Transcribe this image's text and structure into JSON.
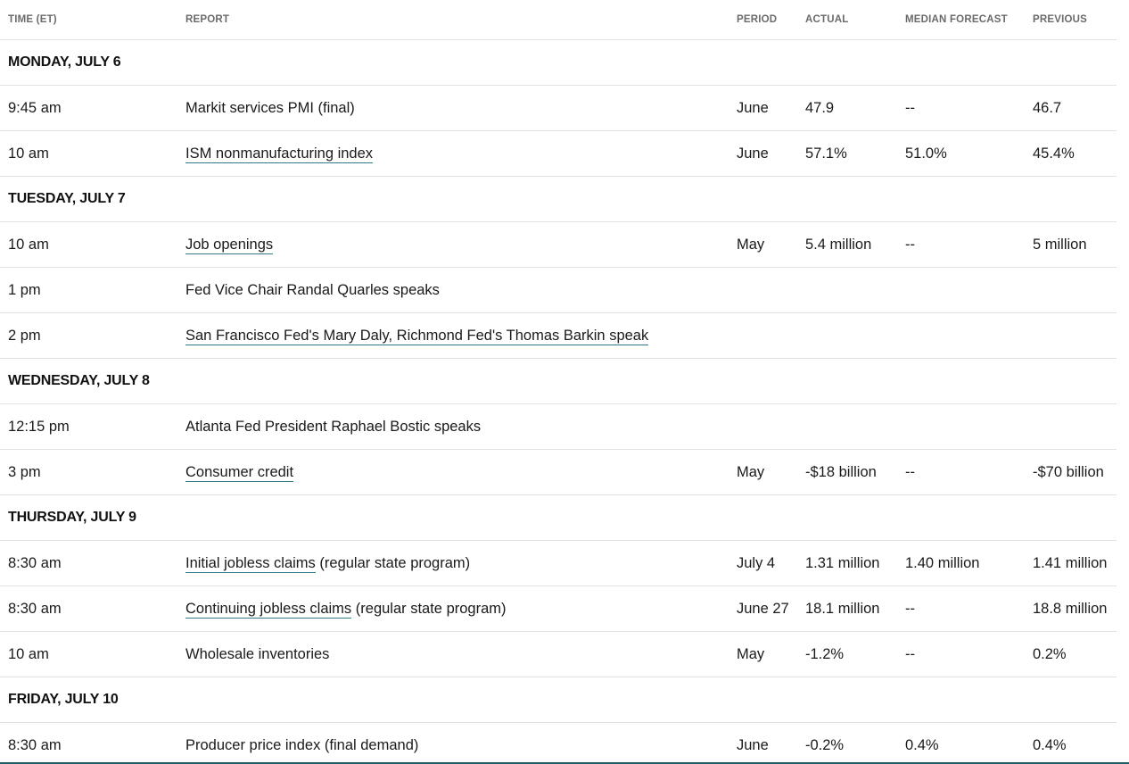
{
  "headers": {
    "time": "TIME (ET)",
    "report": "REPORT",
    "period": "PERIOD",
    "actual": "ACTUAL",
    "median": "MEDIAN FORECAST",
    "previous": "PREVIOUS"
  },
  "colors": {
    "link_underline": "#2f7a8a",
    "divider": "#e2e2e2",
    "header_text": "#6b6b6b"
  },
  "rows": [
    {
      "type": "day",
      "label": "MONDAY, JULY 6"
    },
    {
      "type": "event",
      "time": "9:45 am",
      "report": "Markit services PMI (final)",
      "linked": false,
      "suffix": "",
      "period": "June",
      "actual": "47.9",
      "median": "--",
      "previous": "46.7"
    },
    {
      "type": "event",
      "time": "10 am",
      "report": "ISM nonmanufacturing index",
      "linked": true,
      "suffix": "",
      "period": "June",
      "actual": "57.1%",
      "median": "51.0%",
      "previous": "45.4%"
    },
    {
      "type": "day",
      "label": "TUESDAY, JULY 7"
    },
    {
      "type": "event",
      "time": "10 am",
      "report": "Job openings",
      "linked": true,
      "suffix": "",
      "period": "May",
      "actual": "5.4 million",
      "median": "--",
      "previous": "5 million"
    },
    {
      "type": "event",
      "time": "1 pm",
      "report": "Fed Vice Chair Randal Quarles speaks",
      "linked": false,
      "suffix": "",
      "period": "",
      "actual": "",
      "median": "",
      "previous": ""
    },
    {
      "type": "event",
      "time": "2 pm",
      "report": "San Francisco Fed's Mary Daly, Richmond Fed's Thomas Barkin speak",
      "linked": true,
      "suffix": "",
      "period": "",
      "actual": "",
      "median": "",
      "previous": ""
    },
    {
      "type": "day",
      "label": "WEDNESDAY, JULY 8"
    },
    {
      "type": "event",
      "time": "12:15 pm",
      "report": "Atlanta Fed President Raphael Bostic speaks",
      "linked": false,
      "suffix": "",
      "period": "",
      "actual": "",
      "median": "",
      "previous": ""
    },
    {
      "type": "event",
      "time": "3 pm",
      "report": "Consumer credit",
      "linked": true,
      "suffix": "",
      "period": "May",
      "actual": "-$18 billion",
      "median": "--",
      "previous": "-$70 billion"
    },
    {
      "type": "day",
      "label": "THURSDAY, JULY 9"
    },
    {
      "type": "event",
      "time": "8:30 am",
      "report": "Initial jobless claims",
      "linked": true,
      "suffix": " (regular state program)",
      "period": "July 4",
      "actual": "1.31 million",
      "median": "1.40 million",
      "previous": "1.41 million"
    },
    {
      "type": "event",
      "time": "8:30 am",
      "report": "Continuing jobless claims",
      "linked": true,
      "suffix": " (regular state program)",
      "period": "June 27",
      "actual": "18.1 million",
      "median": "--",
      "previous": "18.8 million"
    },
    {
      "type": "event",
      "time": "10 am",
      "report": "Wholesale inventories",
      "linked": false,
      "suffix": "",
      "period": "May",
      "actual": "-1.2%",
      "median": "--",
      "previous": "0.2%"
    },
    {
      "type": "day",
      "label": "FRIDAY, JULY 10"
    },
    {
      "type": "event",
      "time": "8:30 am",
      "report": "Producer price index (final demand)",
      "linked": false,
      "suffix": "",
      "period": "June",
      "actual": "-0.2%",
      "median": "0.4%",
      "previous": "0.4%"
    }
  ]
}
